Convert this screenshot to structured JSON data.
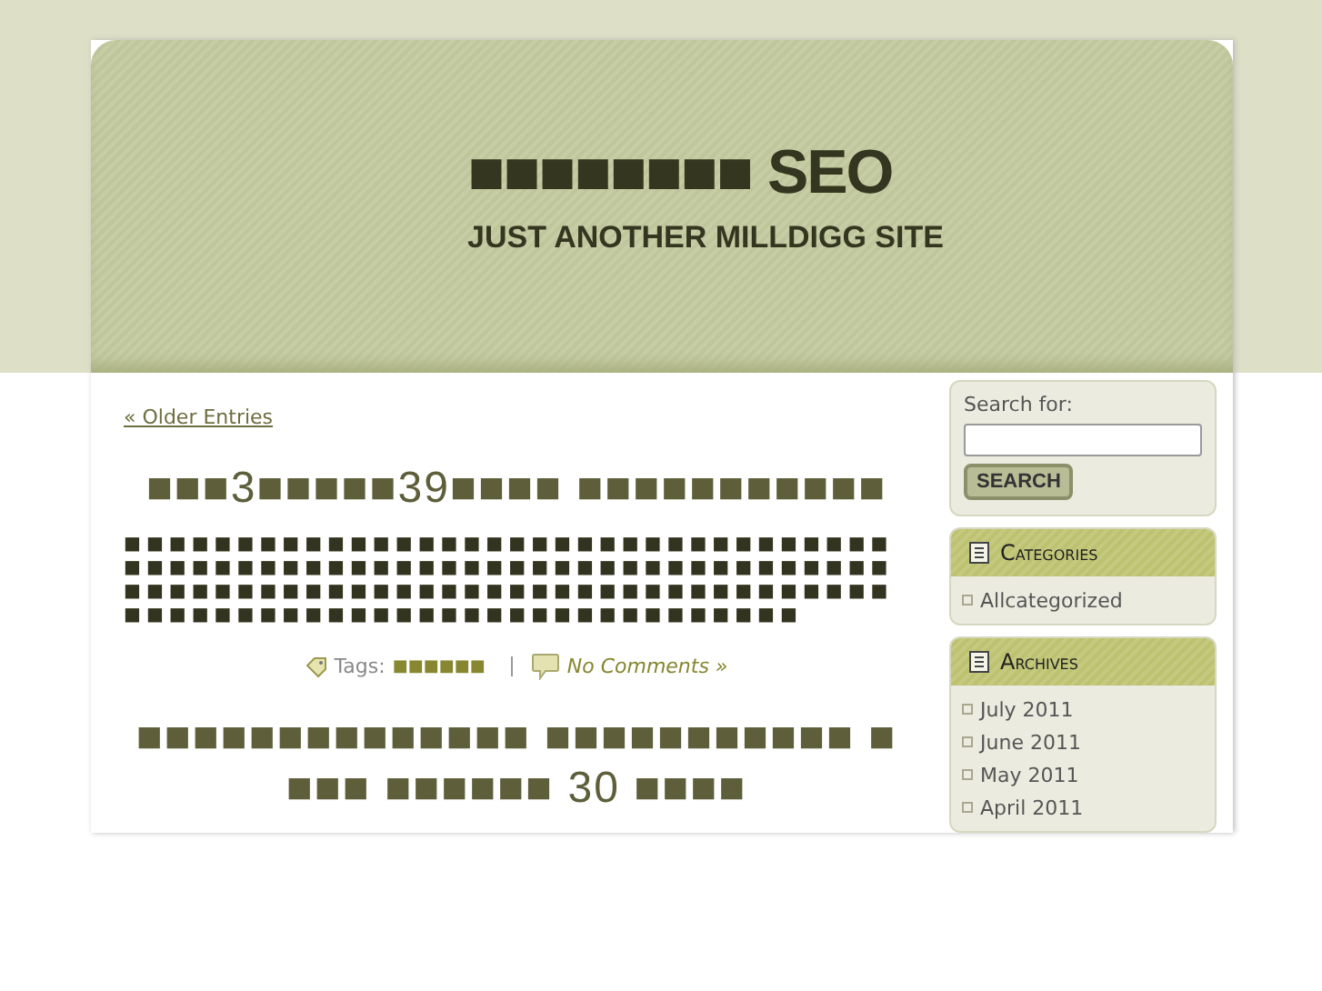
{
  "header": {
    "site_title": "■■■■■■■■ SEO",
    "tagline": "JUST ANOTHER MILLDIGG SITE"
  },
  "navigation": {
    "older_entries": "« Older Entries"
  },
  "posts": [
    {
      "title": "■■■3■■■■■39■■■■ ■■■■■■■■■■■",
      "excerpt": "■■■■■■■■■■■■■■■■■■■■■■■■■■■■■■■■■■■■■■■■■■■■■■■■■■■■■■■■■■■■■■■■■■■■■■■■■■■■■■■■■■■■■■■■■■■■■■■■■■■■■■■■■■■■■■■■■■■■■■■■■■■■■■■■■■■■",
      "tags_label": "Tags:",
      "tags": "■■■■■■",
      "comments": "No Comments »"
    },
    {
      "title": "■■■■■■■■■■■■■■ ■■■■■■■■■■■ ■ ■■■ ■■■■■■ 30 ■■■■"
    }
  ],
  "sidebar": {
    "search": {
      "label": "Search for:",
      "button": "SEARCH"
    },
    "widgets": [
      {
        "title": "Categories",
        "items": [
          "Allcategorized"
        ]
      },
      {
        "title": "Archives",
        "items": [
          "July 2011",
          "June 2011",
          "May 2011",
          "April 2011"
        ]
      }
    ]
  }
}
